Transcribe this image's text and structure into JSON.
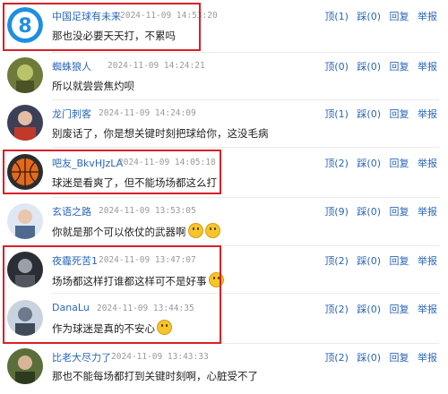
{
  "comments": [
    {
      "user": "中国足球有未来",
      "time": "2024-11-09 14:53:20",
      "text": "那也没必要天天打，不累吗",
      "up": "顶(1)",
      "down": "踩(0)",
      "reply": "回复",
      "report": "举报",
      "avatar_icon": "number-8-avatar-icon"
    },
    {
      "user": "蜘蛛狼人",
      "time": "2024-11-09 14:24:21",
      "text": "所以就尝尝焦灼呗",
      "up": "顶(0)",
      "down": "踩(0)",
      "reply": "回复",
      "report": "举报",
      "avatar_icon": "photo-avatar-icon"
    },
    {
      "user": "龙门刺客",
      "time": "2024-11-09 14:24:09",
      "text": "别废话了，你是想关键时刻把球给你，这没毛病",
      "up": "顶(1)",
      "down": "踩(0)",
      "reply": "回复",
      "report": "举报",
      "avatar_icon": "photo-avatar-icon"
    },
    {
      "user": "吧友_BkvHJzLA",
      "time": "2024-11-09 14:05:18",
      "text": "球迷是看爽了，但不能场场都这么打",
      "up": "顶(2)",
      "down": "踩(0)",
      "reply": "回复",
      "report": "举报",
      "avatar_icon": "basketball-avatar-icon"
    },
    {
      "user": "玄语之路",
      "time": "2024-11-09 13:53:05",
      "text": "你就是那个可以依仗的武器啊",
      "up": "顶(9)",
      "down": "踩(0)",
      "reply": "回复",
      "report": "举报",
      "avatar_icon": "photo-avatar-icon"
    },
    {
      "user": "夜霾死苦1",
      "time": "2024-11-09 13:47:07",
      "text": "场场都这样打谁都这样可不是好事",
      "up": "顶(2)",
      "down": "踩(0)",
      "reply": "回复",
      "report": "举报",
      "avatar_icon": "photo-avatar-icon"
    },
    {
      "user": "DanaLu",
      "time": "2024-11-09 13:44:35",
      "text": "作为球迷是真的不安心",
      "up": "顶(2)",
      "down": "踩(0)",
      "reply": "回复",
      "report": "举报",
      "avatar_icon": "photo-avatar-icon"
    },
    {
      "user": "比老大尽力了",
      "time": "2024-11-09 13:43:33",
      "text": "那也不能每场都打到关键时刻啊，心脏受不了",
      "up": "顶(2)",
      "down": "踩(0)",
      "reply": "回复",
      "report": "举报",
      "avatar_icon": "photo-avatar-icon"
    }
  ],
  "colors": {
    "highlight": "#d92027",
    "link": "#2a66b8",
    "time": "#9a9a9a"
  }
}
